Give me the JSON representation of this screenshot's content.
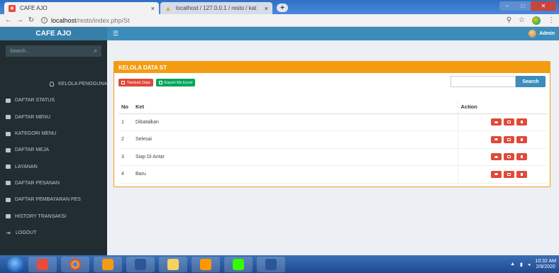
{
  "browser": {
    "tabs": [
      {
        "title": "CAFE AJO",
        "close": "×"
      },
      {
        "title": "localhost / 127.0.0.1 / resto / kat",
        "close": "×"
      }
    ],
    "new_tab": "+",
    "url_host": "localhost",
    "url_path": "/resto/index.php/St"
  },
  "app": {
    "brand": "CAFE AJO",
    "user_name": "Admin"
  },
  "sidebar": {
    "search_placeholder": "Search...",
    "items": [
      {
        "label": "KELOLA PENGGUNA",
        "icon": "user-icon"
      },
      {
        "label": "DAFTAR STATUS",
        "icon": "list-icon"
      },
      {
        "label": "DAFTAR MENU",
        "icon": "list-icon"
      },
      {
        "label": "KATEGORI MENU",
        "icon": "list-icon"
      },
      {
        "label": "DAFTAR MEJA",
        "icon": "list-icon"
      },
      {
        "label": "LAYANAN",
        "icon": "list-icon"
      },
      {
        "label": "DAFTAR PESANAN",
        "icon": "list-icon"
      },
      {
        "label": "DAFTAR PEMBAYARAN PES",
        "icon": "list-icon"
      },
      {
        "label": "HISTORY TRANSAKSI",
        "icon": "list-icon"
      },
      {
        "label": "LOGOUT",
        "icon": "logout-icon"
      }
    ]
  },
  "main": {
    "box_title": "KELOLA DATA ST",
    "add_button": "Tambah Data",
    "export_button": "Export Ms Excel",
    "search_value": "",
    "search_button": "Search",
    "table": {
      "headers": [
        "No",
        "Ket",
        "Action"
      ],
      "rows": [
        {
          "no": "1",
          "ket": "Dibatalkan"
        },
        {
          "no": "2",
          "ket": "Selesai"
        },
        {
          "no": "3",
          "ket": "Siap Di Antar"
        },
        {
          "no": "4",
          "ket": "Baru"
        }
      ]
    }
  },
  "taskbar": {
    "time": "10:32 AM",
    "date": "2/9/2020"
  },
  "colors": {
    "brand": "#367fa9",
    "topbar": "#3c8dbc",
    "sidebar": "#222d32",
    "box_header": "#f39c12",
    "danger": "#dd4b39",
    "success": "#00a65a"
  }
}
